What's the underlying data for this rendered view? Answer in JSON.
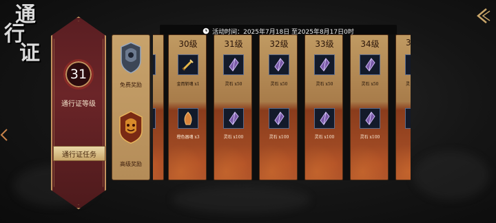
{
  "page": {
    "title_chars": [
      "通",
      "行",
      "证"
    ]
  },
  "header": {
    "event_time": "活动时间：2025年7月18日 至2025年8月17日0时"
  },
  "level_panel": {
    "level_value": "31",
    "level_label": "通行证等级",
    "task_button_label": "通行证任务"
  },
  "reward_types": {
    "free_label": "免费奖励",
    "premium_label": "高级奖励"
  },
  "columns": [
    {
      "level": "",
      "free_item": "",
      "premium_item": "",
      "free_icon": "gold-item-icon",
      "premium_icon": "gold-item-icon"
    },
    {
      "level": "30级",
      "free_item": "金而斩魂 x1",
      "premium_item": "橙色器魂 x3",
      "free_icon": "sword-item-icon",
      "premium_icon": "orange-soul-icon"
    },
    {
      "level": "31级",
      "free_item": "灵石 x50",
      "premium_item": "灵石 x100",
      "free_icon": "spirit-stone-icon",
      "premium_icon": "spirit-stone-icon"
    },
    {
      "level": "32级",
      "free_item": "灵石 x50",
      "premium_item": "灵石 x100",
      "free_icon": "spirit-stone-icon",
      "premium_icon": "spirit-stone-icon"
    },
    {
      "level": "33级",
      "free_item": "灵石 x50",
      "premium_item": "灵石 x100",
      "free_icon": "spirit-stone-icon",
      "premium_icon": "spirit-stone-icon"
    },
    {
      "level": "34级",
      "free_item": "灵石 x50",
      "premium_item": "灵石 x100",
      "free_icon": "spirit-stone-icon",
      "premium_icon": "spirit-stone-icon"
    },
    {
      "level": "3",
      "free_item": "灵",
      "premium_item": "",
      "free_icon": "spirit-stone-icon",
      "premium_icon": "spirit-stone-icon"
    }
  ],
  "colors": {
    "panel_red": "#5a1e22",
    "gold_border": "#c4935e",
    "parchment": "#c09a62",
    "stone_purple": "#7a5aa8"
  }
}
